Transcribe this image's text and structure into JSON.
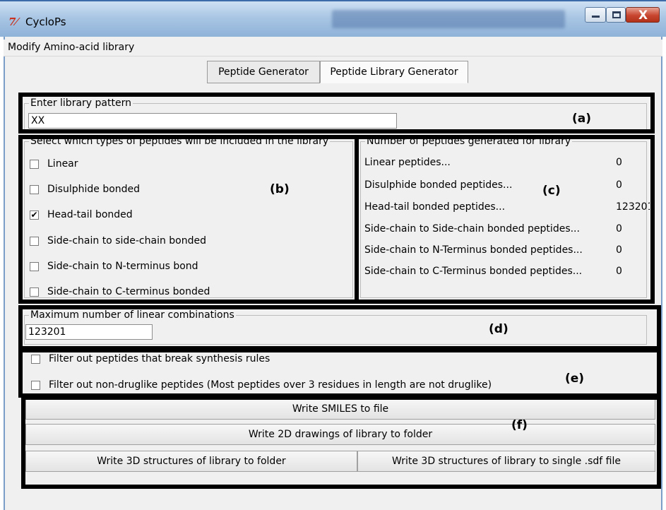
{
  "window": {
    "title": "CycloPs",
    "icon": "tk-feather-icon",
    "icon_glyph": "7⁄",
    "close_glyph": "X"
  },
  "menu": {
    "items": [
      {
        "label": "Modify Amino-acid library"
      }
    ]
  },
  "tabs": [
    {
      "label": "Peptide Generator",
      "selected": false
    },
    {
      "label": "Peptide Library Generator",
      "selected": true
    }
  ],
  "pattern": {
    "title": "Enter library pattern",
    "value": "XX"
  },
  "types": {
    "title": "Select which types of peptides will be included in the library",
    "options": [
      {
        "label": "Linear",
        "checked": false
      },
      {
        "label": "Disulphide bonded",
        "checked": false
      },
      {
        "label": "Head-tail bonded",
        "checked": true
      },
      {
        "label": "Side-chain to side-chain bonded",
        "checked": false
      },
      {
        "label": "Side-chain to N-terminus bond",
        "checked": false
      },
      {
        "label": "Side-chain to C-terminus bonded",
        "checked": false
      }
    ]
  },
  "counts": {
    "title": "Number of peptides generated for library",
    "rows": [
      {
        "label": "Linear peptides...",
        "value": "0"
      },
      {
        "label": "Disulphide bonded peptides...",
        "value": "0"
      },
      {
        "label": "Head-tail bonded peptides...",
        "value": "123201"
      },
      {
        "label": "Side-chain to Side-chain bonded peptides...",
        "value": "0"
      },
      {
        "label": "Side-chain to N-Terminus bonded peptides...",
        "value": "0"
      },
      {
        "label": "Side-chain to C-Terminus bonded peptides...",
        "value": "0"
      }
    ]
  },
  "max_linear": {
    "title": "Maximum number of linear combinations",
    "value": "123201"
  },
  "filters": [
    {
      "label": "Filter out peptides that break synthesis rules",
      "checked": false
    },
    {
      "label": "Filter out non-druglike peptides (Most peptides over 3 residues in length are not druglike)",
      "checked": false
    }
  ],
  "buttons": {
    "write_smiles": "Write SMILES to file",
    "write_2d": "Write 2D drawings of library to folder",
    "write_3d_folder": "Write 3D structures of library to folder",
    "write_3d_sdf": "Write 3D structures of library to single .sdf file"
  },
  "annotations": [
    "(a)",
    "(b)",
    "(c)",
    "(d)",
    "(e)",
    "(f)"
  ],
  "colors": {
    "annotation_border": "#000000",
    "title_bar": "#a9c6e4",
    "close_button": "#c7452f"
  }
}
